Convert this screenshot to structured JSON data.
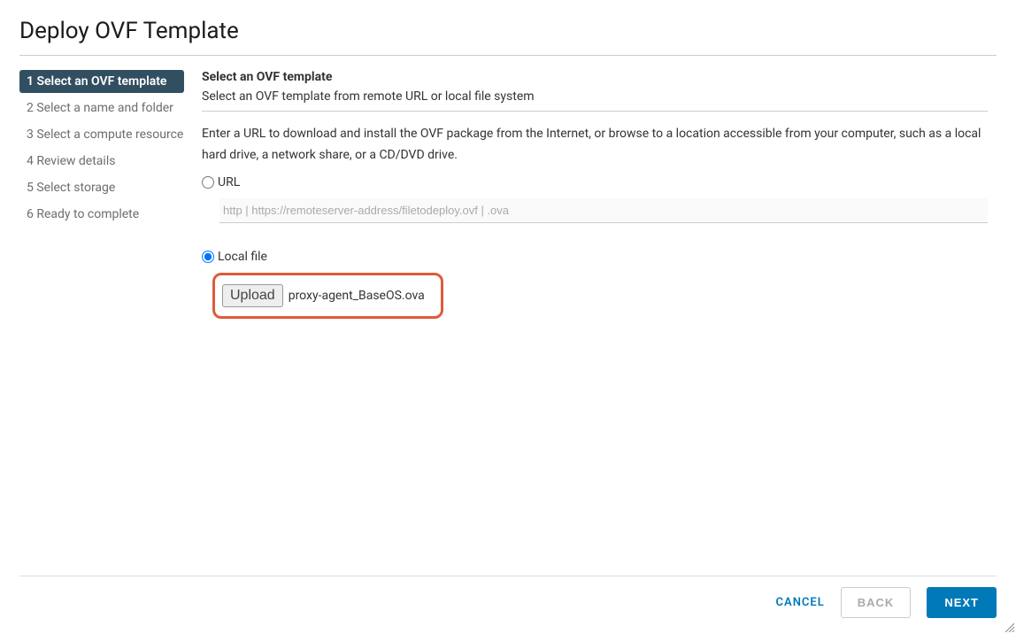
{
  "header": {
    "title": "Deploy OVF Template"
  },
  "sidebar": {
    "steps": [
      {
        "label": "1 Select an OVF template",
        "active": true
      },
      {
        "label": "2 Select a name and folder",
        "active": false
      },
      {
        "label": "3 Select a compute resource",
        "active": false
      },
      {
        "label": "4 Review details",
        "active": false
      },
      {
        "label": "5 Select storage",
        "active": false
      },
      {
        "label": "6 Ready to complete",
        "active": false
      }
    ]
  },
  "content": {
    "title": "Select an OVF template",
    "subtitle": "Select an OVF template from remote URL or local file system",
    "instruction": "Enter a URL to download and install the OVF package from the Internet, or browse to a location accessible from your computer, such as a local hard drive, a network share, or a CD/DVD drive.",
    "url_label": "URL",
    "url_placeholder": "http | https://remoteserver-address/filetodeploy.ovf | .ova",
    "localfile_label": "Local file",
    "upload_button": "Upload",
    "filename": "proxy-agent_BaseOS.ova",
    "selected_option": "local"
  },
  "footer": {
    "cancel": "CANCEL",
    "back": "BACK",
    "next": "NEXT"
  }
}
